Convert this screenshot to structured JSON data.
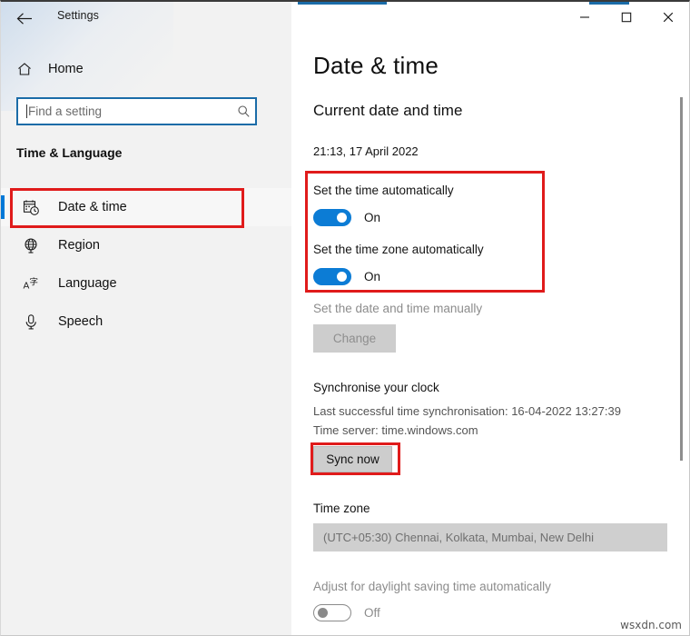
{
  "window": {
    "title": "Settings",
    "back_icon": "back-arrow-icon",
    "minimize_label": "Minimize",
    "maximize_label": "Maximize",
    "close_label": "Close"
  },
  "sidebar": {
    "home_label": "Home",
    "home_icon": "home-icon",
    "search": {
      "placeholder": "Find a setting",
      "icon": "search-icon"
    },
    "section_title": "Time & Language",
    "items": [
      {
        "label": "Date & time",
        "icon": "calendar-clock-icon",
        "selected": true
      },
      {
        "label": "Region",
        "icon": "globe-icon",
        "selected": false
      },
      {
        "label": "Language",
        "icon": "language-icon",
        "selected": false
      },
      {
        "label": "Speech",
        "icon": "microphone-icon",
        "selected": false
      }
    ]
  },
  "main": {
    "page_title": "Date & time",
    "current_section_heading": "Current date and time",
    "current_datetime": "21:13, 17 April 2022",
    "set_time_auto": {
      "label": "Set the time automatically",
      "state": "On",
      "on": true
    },
    "set_timezone_auto": {
      "label": "Set the time zone automatically",
      "state": "On",
      "on": true
    },
    "manual_section": {
      "label": "Set the date and time manually",
      "button_label": "Change",
      "button_disabled": true
    },
    "sync_section": {
      "heading": "Synchronise your clock",
      "last_sync": "Last successful time synchronisation: 16-04-2022 13:27:39",
      "time_server": "Time server: time.windows.com",
      "button_label": "Sync now"
    },
    "timezone_section": {
      "heading": "Time zone",
      "selected_value": "(UTC+05:30) Chennai, Kolkata, Mumbai, New Delhi",
      "disabled": true
    },
    "dst_section": {
      "label": "Adjust for daylight saving time automatically",
      "state": "Off",
      "on": false
    }
  },
  "annotations": {
    "highlight_color": "#e01b1b",
    "accent_color": "#0078d7",
    "toggle_on_color": "#0c7cd5"
  },
  "watermark": "wsxdn.com"
}
